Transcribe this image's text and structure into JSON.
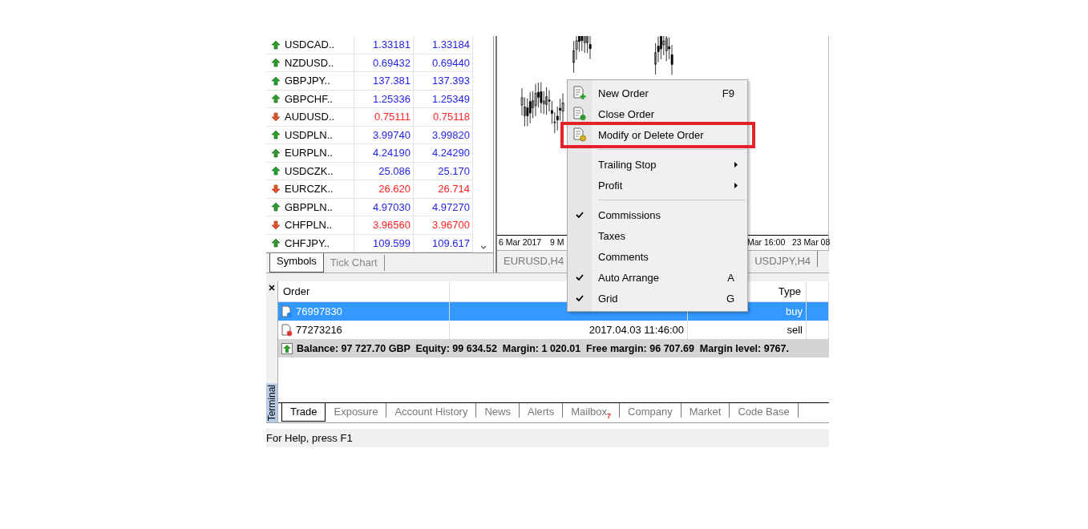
{
  "market_watch": {
    "rows": [
      {
        "symbol": "USDCAD..",
        "bid": "1.33181",
        "ask": "1.33184",
        "kind": "up"
      },
      {
        "symbol": "NZDUSD..",
        "bid": "0.69432",
        "ask": "0.69440",
        "kind": "up"
      },
      {
        "symbol": "GBPJPY..",
        "bid": "137.381",
        "ask": "137.393",
        "kind": "up"
      },
      {
        "symbol": "GBPCHF..",
        "bid": "1.25336",
        "ask": "1.25349",
        "kind": "up"
      },
      {
        "symbol": "AUDUSD..",
        "bid": "0.75111",
        "ask": "0.75118",
        "kind": "down"
      },
      {
        "symbol": "USDPLN..",
        "bid": "3.99740",
        "ask": "3.99820",
        "kind": "up"
      },
      {
        "symbol": "EURPLN..",
        "bid": "4.24190",
        "ask": "4.24290",
        "kind": "up"
      },
      {
        "symbol": "USDCZK..",
        "bid": "25.086",
        "ask": "25.170",
        "kind": "up"
      },
      {
        "symbol": "EURCZK..",
        "bid": "26.620",
        "ask": "26.714",
        "kind": "down"
      },
      {
        "symbol": "GBPPLN..",
        "bid": "4.97030",
        "ask": "4.97270",
        "kind": "up"
      },
      {
        "symbol": "CHFPLN..",
        "bid": "3.96560",
        "ask": "3.96700",
        "kind": "down"
      },
      {
        "symbol": "CHFJPY..",
        "bid": "109.599",
        "ask": "109.617",
        "kind": "up"
      }
    ],
    "tabs": [
      {
        "label": "Symbols",
        "selected": true
      },
      {
        "label": "Tick Chart",
        "selected": false
      }
    ]
  },
  "chart": {
    "time_labels": [
      "6 Mar 2017",
      "9 M",
      "Mar 16:00",
      "23 Mar 08"
    ],
    "tabs": [
      {
        "label": "EURUSD,H4",
        "selected": false
      },
      {
        "label": "USDJPY,H4",
        "selected": false
      }
    ]
  },
  "context_menu": {
    "items": [
      {
        "kind": "action",
        "label": "New Order",
        "shortcut": "F9",
        "highlighted": false
      },
      {
        "kind": "action",
        "label": "Close Order",
        "highlighted": false
      },
      {
        "kind": "action",
        "label": "Modify or Delete Order",
        "highlighted": true
      },
      {
        "kind": "separator"
      },
      {
        "kind": "submenu",
        "label": "Trailing Stop"
      },
      {
        "kind": "submenu",
        "label": "Profit"
      },
      {
        "kind": "separator"
      },
      {
        "kind": "check",
        "label": "Commissions",
        "checked": true
      },
      {
        "kind": "check",
        "label": "Taxes",
        "checked": false
      },
      {
        "kind": "check",
        "label": "Comments",
        "checked": false
      },
      {
        "kind": "check",
        "label": "Auto Arrange",
        "shortcut": "A",
        "checked": true
      },
      {
        "kind": "check",
        "label": "Grid",
        "shortcut": "G",
        "checked": true
      }
    ]
  },
  "terminal": {
    "title": "Terminal",
    "columns": [
      "Order",
      "Type"
    ],
    "orders": [
      {
        "order": "76997830",
        "type": "buy",
        "selected": true,
        "color": "#1e88e5"
      },
      {
        "order": "77273216",
        "time": "2017.04.03 11:46:00",
        "type": "sell",
        "selected": false,
        "color": "#e53935"
      }
    ],
    "summary": "Balance: 97 727.70 GBP  Equity: 99 634.52  Margin: 1 020.01  Free margin: 96 707.69  Margin level: 9767.",
    "tabs": [
      {
        "label": "Trade",
        "selected": true
      },
      {
        "label": "Exposure",
        "selected": false
      },
      {
        "label": "Account History",
        "selected": false
      },
      {
        "label": "News",
        "selected": false
      },
      {
        "label": "Alerts",
        "selected": false
      },
      {
        "label": "Mailbox",
        "badge": "7",
        "selected": false
      },
      {
        "label": "Company",
        "selected": false
      },
      {
        "label": "Market",
        "selected": false
      },
      {
        "label": "Code Base",
        "selected": false
      }
    ]
  },
  "status_bar": "For Help, press F1"
}
